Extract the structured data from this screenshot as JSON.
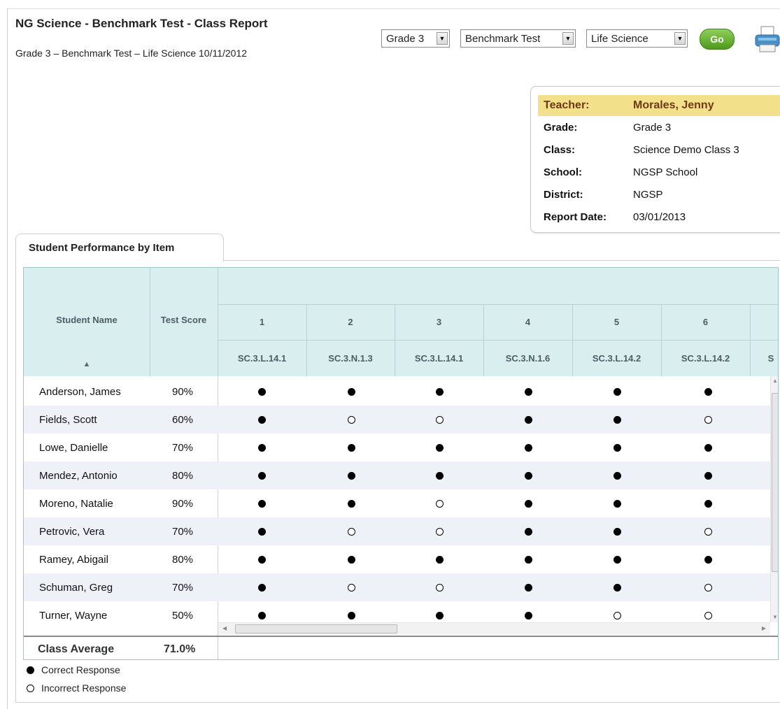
{
  "header": {
    "title": "NG Science - Benchmark Test - Class Report",
    "subtitle": "Grade 3 – Benchmark Test – Life Science 10/11/2012"
  },
  "filters": {
    "grade": "Grade 3",
    "test": "Benchmark Test",
    "subject": "Life Science",
    "go_label": "Go"
  },
  "info": {
    "teacher_label": "Teacher:",
    "teacher": "Morales, Jenny",
    "grade_label": "Grade:",
    "grade": "Grade 3",
    "class_label": "Class:",
    "class": "Science Demo Class 3",
    "school_label": "School:",
    "school": "NGSP School",
    "district_label": "District:",
    "district": "NGSP",
    "report_date_label": "Report Date:",
    "report_date": "03/01/2013"
  },
  "tab": {
    "label": "Student Performance by Item"
  },
  "table": {
    "student_name_header": "Student Name",
    "test_score_header": "Test Score",
    "sort_icon": "▲",
    "items": [
      {
        "num": "1",
        "code": "SC.3.L.14.1"
      },
      {
        "num": "2",
        "code": "SC.3.N.1.3"
      },
      {
        "num": "3",
        "code": "SC.3.L.14.1"
      },
      {
        "num": "4",
        "code": "SC.3.N.1.6"
      },
      {
        "num": "5",
        "code": "SC.3.L.14.2"
      },
      {
        "num": "6",
        "code": "SC.3.L.14.2"
      },
      {
        "num": "",
        "code": "S"
      }
    ],
    "students": [
      {
        "name": "Anderson, James",
        "score": "90%",
        "responses": [
          "correct",
          "correct",
          "correct",
          "correct",
          "correct",
          "correct"
        ]
      },
      {
        "name": "Fields, Scott",
        "score": "60%",
        "responses": [
          "correct",
          "incorrect",
          "incorrect",
          "correct",
          "correct",
          "incorrect"
        ]
      },
      {
        "name": "Lowe, Danielle",
        "score": "70%",
        "responses": [
          "correct",
          "correct",
          "correct",
          "correct",
          "correct",
          "correct"
        ]
      },
      {
        "name": "Mendez, Antonio",
        "score": "80%",
        "responses": [
          "correct",
          "correct",
          "correct",
          "correct",
          "correct",
          "correct"
        ]
      },
      {
        "name": "Moreno, Natalie",
        "score": "90%",
        "responses": [
          "correct",
          "correct",
          "incorrect",
          "correct",
          "correct",
          "correct"
        ]
      },
      {
        "name": "Petrovic, Vera",
        "score": "70%",
        "responses": [
          "correct",
          "incorrect",
          "incorrect",
          "correct",
          "correct",
          "incorrect"
        ]
      },
      {
        "name": "Ramey, Abigail",
        "score": "80%",
        "responses": [
          "correct",
          "correct",
          "correct",
          "correct",
          "correct",
          "correct"
        ]
      },
      {
        "name": "Schuman, Greg",
        "score": "70%",
        "responses": [
          "correct",
          "incorrect",
          "incorrect",
          "correct",
          "correct",
          "incorrect"
        ]
      },
      {
        "name": "Turner, Wayne",
        "score": "50%",
        "responses": [
          "correct",
          "correct",
          "correct",
          "correct",
          "incorrect",
          "incorrect"
        ]
      }
    ],
    "class_average_label": "Class Average",
    "class_average": "71.0%"
  },
  "legend": {
    "correct": "Correct Response",
    "incorrect": "Incorrect Response"
  }
}
